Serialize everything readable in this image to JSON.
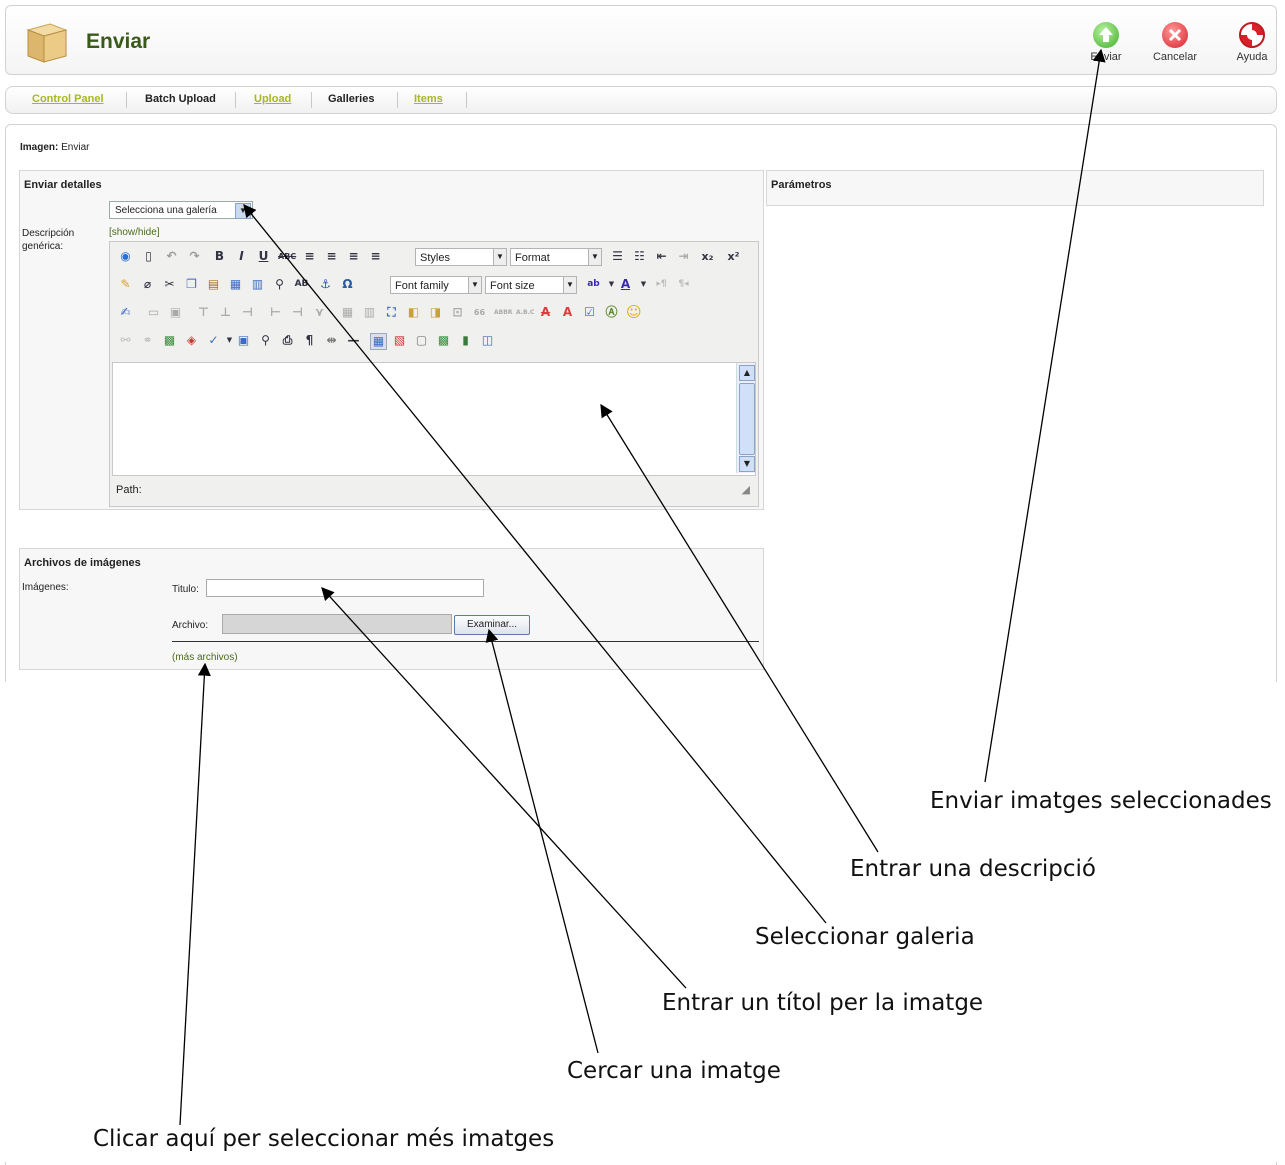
{
  "toolbar": {
    "title": "Enviar",
    "buttons": [
      {
        "label": "Enviar",
        "icon": "upload-icon",
        "color": "#3fae2a"
      },
      {
        "label": "Cancelar",
        "icon": "cancel-icon",
        "color": "#d8202a"
      },
      {
        "label": "Ayuda",
        "icon": "help-icon",
        "color": "#d8202a"
      }
    ]
  },
  "submenu": {
    "items": [
      "Control Panel",
      "Batch Upload",
      "Upload",
      "Galleries",
      "Items"
    ]
  },
  "main": {
    "heading_label": "Imagen:",
    "heading_value": "Enviar",
    "details": {
      "title": "Enviar detalles",
      "gallery_select": "Selecciona una galería",
      "description_label": "Descripción genérica:",
      "show_hide": "[show/hide]"
    },
    "params": {
      "title": "Parámetros"
    },
    "editor": {
      "styles": "Styles",
      "format": "Format",
      "font_family": "Font family",
      "font_size": "Font size",
      "path_label": "Path:"
    },
    "files": {
      "title": "Archivos de imágenes",
      "images_label": "Imágenes:",
      "title_label": "Titulo:",
      "file_label": "Archivo:",
      "browse": "Examinar...",
      "more_files": "(más archivos)"
    }
  },
  "callouts": {
    "send": "Enviar imatges seleccionades",
    "description": "Entrar una descripció",
    "gallery": "Seleccionar galeria",
    "title": "Entrar un títol per la imatge",
    "browse": "Cercar una imatge",
    "more": "Clicar aquí per seleccionar més imatges"
  },
  "colors": {
    "link": "#a6b822",
    "title": "#3a5a1a"
  }
}
